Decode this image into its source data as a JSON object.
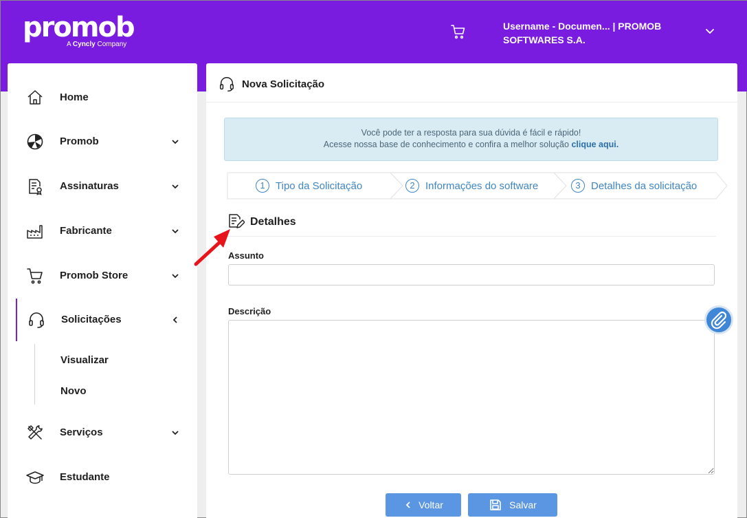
{
  "header": {
    "logo": {
      "name": "promob",
      "tagline_prefix": "A",
      "tagline_brand": "Cyncly",
      "tagline_suffix": "Company"
    },
    "user": "Username - Documen... | PROMOB SOFTWARES S.A.",
    "icons": [
      "cart-icon",
      "chevron-down-icon"
    ]
  },
  "sidebar": {
    "items": [
      {
        "label": "Home",
        "icon": "home-icon"
      },
      {
        "label": "Promob",
        "icon": "promob-icon"
      },
      {
        "label": "Assinaturas",
        "icon": "document-badge-icon"
      },
      {
        "label": "Fabricante",
        "icon": "factory-icon"
      },
      {
        "label": "Promob Store",
        "icon": "cart-icon"
      },
      {
        "label": "Solicitações",
        "icon": "headset-icon"
      },
      {
        "label": "Serviços",
        "icon": "tools-icon"
      },
      {
        "label": "Estudante",
        "icon": "graduation-cap-icon"
      }
    ],
    "sub_items": [
      "Visualizar",
      "Novo"
    ]
  },
  "main": {
    "title": "Nova Solicitação",
    "alert": {
      "line1": "Você pode ter a resposta para sua dúvida é fácil e rápido!",
      "line2_prefix": "Acesse nossa base de conhecimento e confira a melhor solução",
      "link": "clique aqui."
    },
    "steps": [
      {
        "num": "1",
        "label": "Tipo da Solicitação"
      },
      {
        "num": "2",
        "label": "Informações do software"
      },
      {
        "num": "3",
        "label": "Detalhes da solicitação"
      }
    ],
    "section_title": "Detalhes",
    "fields": {
      "subject_label": "Assunto",
      "subject_value": "",
      "description_label": "Descrição",
      "description_value": ""
    },
    "buttons": {
      "back": "Voltar",
      "save": "Salvar"
    }
  },
  "colors": {
    "brand": "#7a1be0",
    "accent": "#3f86c4",
    "button": "#5b96e2",
    "alert_bg": "#d9ecf4",
    "annotation_arrow": "#e8141b"
  }
}
